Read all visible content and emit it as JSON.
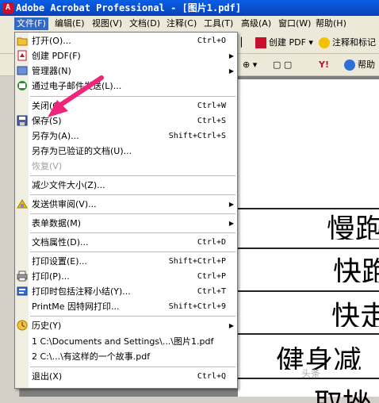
{
  "window": {
    "title": "Adobe Acrobat Professional - [图片1.pdf]",
    "app_icon": "acrobat-icon"
  },
  "menubar": [
    {
      "label": "文件(F)",
      "name": "menu-file",
      "active": true
    },
    {
      "label": "编辑(E)",
      "name": "menu-edit"
    },
    {
      "label": "视图(V)",
      "name": "menu-view"
    },
    {
      "label": "文档(D)",
      "name": "menu-document"
    },
    {
      "label": "注释(C)",
      "name": "menu-comments"
    },
    {
      "label": "工具(T)",
      "name": "menu-tools"
    },
    {
      "label": "高级(A)",
      "name": "menu-advanced"
    },
    {
      "label": "窗口(W)",
      "name": "menu-window"
    },
    {
      "label": "帮助(H)",
      "name": "menu-help"
    }
  ],
  "toolbar": {
    "create_pdf": "创建 PDF",
    "comment_markup": "注释和标记",
    "help": "帮助"
  },
  "file_menu": {
    "items": [
      {
        "label": "打开(O)...",
        "shortcut": "Ctrl+O",
        "icon": "open-folder-icon"
      },
      {
        "label": "创建 PDF(F)",
        "submenu": true,
        "icon": "create-pdf-icon"
      },
      {
        "label": "管理器(N)",
        "submenu": true,
        "icon": "organizer-icon"
      },
      {
        "label": "通过电子邮件发送(L)...",
        "icon": "email-icon"
      },
      {
        "label": "关闭(C)",
        "shortcut": "Ctrl+W"
      },
      {
        "label": "保存(S)",
        "shortcut": "Ctrl+S",
        "icon": "save-disk-icon"
      },
      {
        "label": "另存为(A)...",
        "shortcut": "Shift+Ctrl+S"
      },
      {
        "label": "另存为已验证的文档(U)..."
      },
      {
        "label": "恢复(V)",
        "disabled": true
      },
      {
        "label": "减少文件大小(Z)..."
      },
      {
        "label": "发送供审阅(V)...",
        "submenu": true,
        "icon": "send-review-icon"
      },
      {
        "label": "表单数据(M)",
        "submenu": true
      },
      {
        "label": "文档属性(D)...",
        "shortcut": "Ctrl+D"
      },
      {
        "label": "打印设置(E)...",
        "shortcut": "Shift+Ctrl+P"
      },
      {
        "label": "打印(P)...",
        "shortcut": "Ctrl+P",
        "icon": "printer-icon"
      },
      {
        "label": "打印时包括注释小结(Y)...",
        "shortcut": "Ctrl+T",
        "icon": "print-summary-icon"
      },
      {
        "label": "PrintMe 因特网打印...",
        "shortcut": "Shift+Ctrl+9"
      },
      {
        "label": "历史(Y)",
        "submenu": true,
        "icon": "history-icon"
      },
      {
        "label": "1 C:\\Documents and Settings\\...\\图片1.pdf"
      },
      {
        "label": "2 C:\\...\\有这样的一个故事.pdf"
      },
      {
        "label": "退出(X)",
        "shortcut": "Ctrl+Q"
      }
    ]
  },
  "document": {
    "lines": [
      "慢跑",
      "快跑",
      "快走",
      "健身减",
      "取挫"
    ]
  },
  "watermark": "头条"
}
